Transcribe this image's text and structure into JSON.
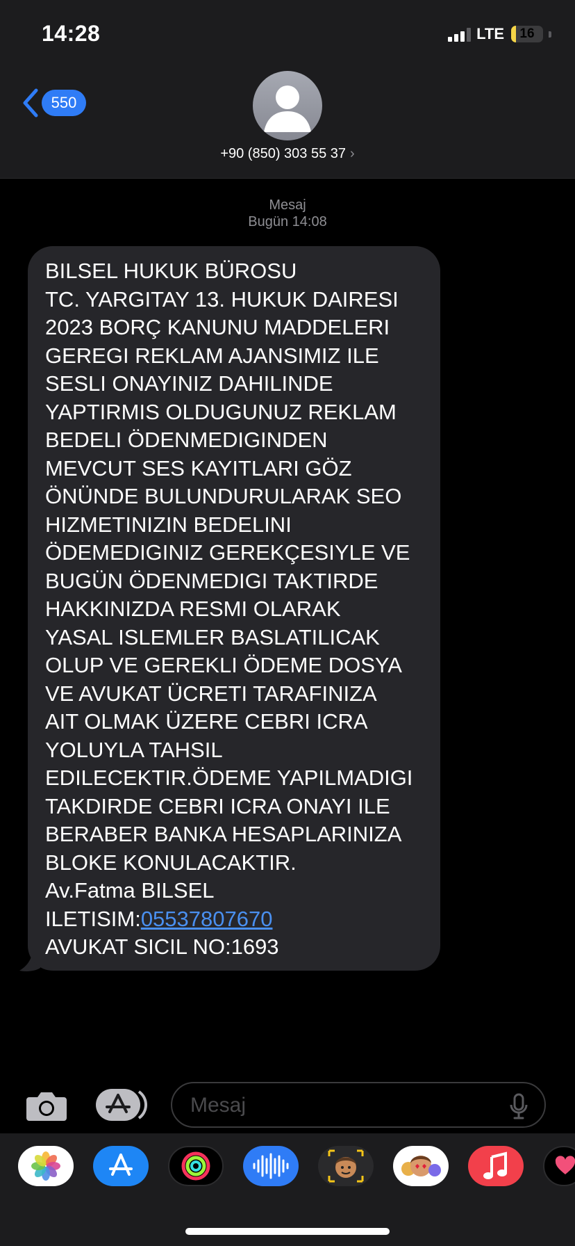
{
  "status_bar": {
    "time": "14:28",
    "network": "LTE",
    "battery_level": "16",
    "signal_bars_active": 3,
    "battery_fill_fraction": 0.16,
    "battery_color": "#f5d547"
  },
  "header": {
    "back_count": "550",
    "contact_name": "+90 (850) 303 55 37",
    "contact_chevron": "›",
    "avatar_icon": "person-silhouette-icon"
  },
  "conversation": {
    "service_label": "Mesaj",
    "timestamp": "Bugün 14:08",
    "message": {
      "lines": [
        "BILSEL HUKUK BÜROSU",
        "TC. YARGITAY 13. HUKUK DAIRESI",
        "2023 BORÇ KANUNU MADDELERI",
        "GEREGI REKLAM AJANSIMIZ ILE",
        "SESLI ONAYINIZ DAHILINDE",
        "YAPTIRMIS OLDUGUNUZ REKLAM",
        "BEDELI ÖDENMEDIGINDEN",
        "MEVCUT SES KAYITLARI GÖZ",
        "ÖNÜNDE BULUNDURULARAK SEO",
        "HIZMETINIZIN BEDELINI",
        "ÖDEMEDIGINIZ GEREKÇESIYLE VE",
        "BUGÜN ÖDENMEDIGI TAKTIRDE",
        "HAKKINIZDA RESMI OLARAK",
        "YASAL ISLEMLER BASLATILICAK",
        "OLUP VE GEREKLI ÖDEME DOSYA",
        "VE AVUKAT ÜCRETI TARAFINIZA",
        "AIT OLMAK ÜZERE CEBRI ICRA",
        "YOLUYLA TAHSIL",
        "EDILECEKTIR.ÖDEME YAPILMADIGI",
        "TAKDIRDE CEBRI ICRA ONAYI ILE",
        "BERABER BANKA HESAPLARINIZA",
        "BLOKE KONULACAKTIR.",
        "Av.Fatma BILSEL"
      ],
      "contact_prefix": "ILETISIM:",
      "contact_phone": "05537807670",
      "registry_line": "AVUKAT SICIL NO:1693"
    }
  },
  "composer": {
    "placeholder": "Mesaj",
    "camera_icon": "camera-icon",
    "apps_icon": "app-store-icon",
    "mic_icon": "microphone-icon"
  },
  "app_drawer": {
    "apps": [
      {
        "name": "photos-app-icon",
        "bg": "#ffffff"
      },
      {
        "name": "app-store-app-icon",
        "bg": "#1e86f5"
      },
      {
        "name": "activity-app-icon",
        "bg": "#000000"
      },
      {
        "name": "audio-message-app-icon",
        "bg": "#2f7cf6"
      },
      {
        "name": "memoji-app-icon",
        "bg": "#1c1c1e"
      },
      {
        "name": "memoji-stickers-app-icon",
        "bg": "#ffffff"
      },
      {
        "name": "music-app-icon",
        "bg": "#f2404b"
      },
      {
        "name": "digital-touch-app-icon",
        "bg": "#000000"
      }
    ]
  },
  "colors": {
    "accent": "#2f7cf6",
    "bubble_bg": "#26262a",
    "header_bg": "#1c1c1e",
    "secondary_text": "#8e8e93",
    "link": "#4a90f0"
  }
}
